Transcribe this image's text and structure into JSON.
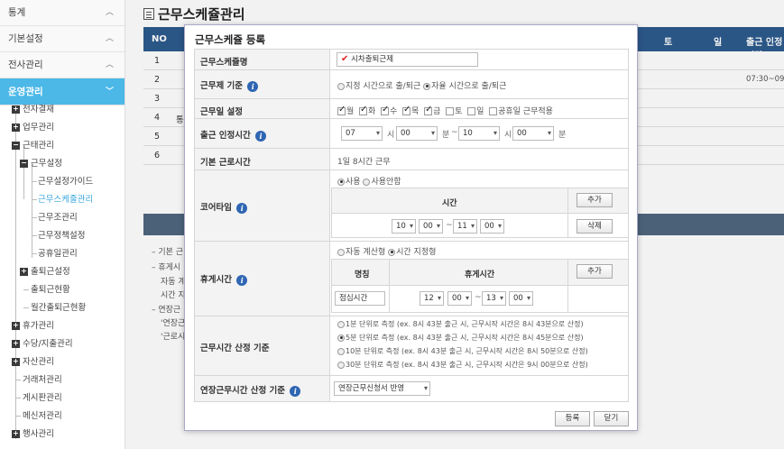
{
  "sidebar": {
    "top": [
      {
        "label": "통계"
      },
      {
        "label": "기본설정"
      },
      {
        "label": "전사관리"
      },
      {
        "label": "운영관리"
      }
    ],
    "tree": [
      {
        "label": "전자결재",
        "pm": "+"
      },
      {
        "label": "업무관리",
        "pm": "+"
      },
      {
        "label": "근태관리",
        "pm": "−"
      },
      {
        "label": "근무설정",
        "pm": "−"
      },
      {
        "label": "근무설정가이드"
      },
      {
        "label": "근무스케줄관리"
      },
      {
        "label": "근무조관리"
      },
      {
        "label": "근무정책설정"
      },
      {
        "label": "공휴일관리"
      },
      {
        "label": "출퇴근설정",
        "pm": "+"
      },
      {
        "label": "출퇴근현황"
      },
      {
        "label": "월간출퇴근현황"
      },
      {
        "label": "휴가관리",
        "pm": "+"
      },
      {
        "label": "수당/지출관리",
        "pm": "+"
      },
      {
        "label": "자산관리",
        "pm": "+"
      },
      {
        "label": "거래처관리"
      },
      {
        "label": "게시판관리"
      },
      {
        "label": "메신저관리"
      },
      {
        "label": "행사관리",
        "pm": "+"
      }
    ]
  },
  "page": {
    "title": "근무스케쥴관리",
    "table_head": {
      "no": "NO",
      "sat": "토",
      "sun": "일",
      "hours": "출근 인정시간"
    },
    "rows": [
      "1",
      "2",
      "3",
      "4",
      "5",
      "6"
    ],
    "row4_extra": "통",
    "row2_time": "07:30~09:00",
    "bg_texts": [
      "– 기본 근",
      "– 휴게시",
      "자동 계",
      "시간 지",
      "– 연장근",
      "'연장근",
      "'근로시"
    ]
  },
  "modal": {
    "title": "근무스케쥴 등록",
    "name_label": "근무스케쥴명",
    "name_value": "시차출퇴근제",
    "criteria_label": "근무제 기준",
    "criteria_options": [
      "지정 시간으로 출/퇴근",
      "자율 시간으로 출/퇴근"
    ],
    "days_label": "근무일 설정",
    "days": [
      "월",
      "화",
      "수",
      "목",
      "금",
      "토",
      "일",
      "공휴일 근무적용"
    ],
    "checkin_label": "출근 인정시간",
    "checkin": {
      "h1": "07",
      "m1": "00",
      "h2": "10",
      "m2": "00",
      "hour_unit": "시",
      "min_unit": "분",
      "tilde": "~",
      "min_tail": "분"
    },
    "base_label": "기본 근로시간",
    "base_value": "1일 8시간 근무",
    "core_label": "코어타임",
    "core_options": [
      "사용",
      "사용안함"
    ],
    "core_time_head": "시간",
    "core_add": "추가",
    "core_time": {
      "h1": "10",
      "m1": "00",
      "h2": "11",
      "m2": "00",
      "tilde": "~"
    },
    "core_delete": "삭제",
    "break_label": "휴게시간",
    "break_options": [
      "자동 계산형",
      "시간 지정형"
    ],
    "break_head_name": "명칭",
    "break_head_time": "휴게시간",
    "break_add": "추가",
    "break_name": "점심시간",
    "break_time": {
      "h1": "12",
      "m1": "00",
      "h2": "13",
      "m2": "00",
      "tilde": "~"
    },
    "calc_label": "근무시간 산정 기준",
    "calc_options": [
      "1분 단위로 측정  (ex. 8시 43분 출근 시, 근무시작 시간은 8시 43분으로 산정)",
      "5분 단위로 측정  (ex. 8시 43분 출근 시, 근무시작 시간은 8시 45분으로 산정)",
      "10분 단위로 측정  (ex. 8시 43분 출근 시, 근무시작 시간은 8시 50분으로 산정)",
      "30분 단위로 측정  (ex. 8시 43분 출근 시, 근무시작 시간은 9시 00분으로 산정)"
    ],
    "overtime_label": "연장근무시간 산정 기준",
    "overtime_value": "연장근무신청서 반영",
    "register": "등록",
    "close": "닫기"
  }
}
